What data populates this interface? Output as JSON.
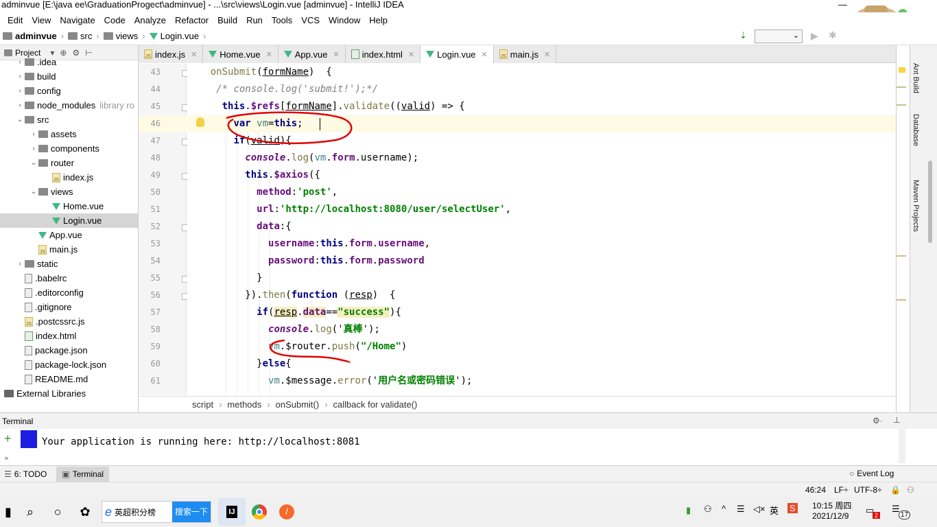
{
  "window": {
    "title": "adminvue [E:\\java ee\\GraduationProgect\\adminvue] - ...\\src\\views\\Login.vue [adminvue] - IntelliJ IDEA",
    "minimize": "—"
  },
  "menu": [
    "Edit",
    "View",
    "Navigate",
    "Code",
    "Analyze",
    "Refactor",
    "Build",
    "Run",
    "Tools",
    "VCS",
    "Window",
    "Help"
  ],
  "nav": {
    "project": "adminvue",
    "src": "src",
    "views": "views",
    "file": "Login.vue"
  },
  "sidebar": {
    "title": "Project",
    "library_label": "library ro"
  },
  "tree": [
    {
      "label": ".idea",
      "indent": 1,
      "arrow": "›",
      "icon": "folder"
    },
    {
      "label": "build",
      "indent": 1,
      "arrow": "›",
      "icon": "folder"
    },
    {
      "label": "config",
      "indent": 1,
      "arrow": "›",
      "icon": "folder"
    },
    {
      "label": "node_modules",
      "indent": 1,
      "arrow": "›",
      "icon": "folder",
      "muted": "library ro"
    },
    {
      "label": "src",
      "indent": 1,
      "arrow": "⌄",
      "icon": "folder"
    },
    {
      "label": "assets",
      "indent": 2,
      "arrow": "›",
      "icon": "folder"
    },
    {
      "label": "components",
      "indent": 2,
      "arrow": "›",
      "icon": "folder"
    },
    {
      "label": "router",
      "indent": 2,
      "arrow": "⌄",
      "icon": "folder"
    },
    {
      "label": "index.js",
      "indent": 3,
      "arrow": "",
      "icon": "js"
    },
    {
      "label": "views",
      "indent": 2,
      "arrow": "⌄",
      "icon": "folder"
    },
    {
      "label": "Home.vue",
      "indent": 3,
      "arrow": "",
      "icon": "vue"
    },
    {
      "label": "Login.vue",
      "indent": 3,
      "arrow": "",
      "icon": "vue",
      "selected": true
    },
    {
      "label": "App.vue",
      "indent": 2,
      "arrow": "",
      "icon": "vue"
    },
    {
      "label": "main.js",
      "indent": 2,
      "arrow": "",
      "icon": "js"
    },
    {
      "label": "static",
      "indent": 1,
      "arrow": "›",
      "icon": "folder"
    },
    {
      "label": ".babelrc",
      "indent": 1,
      "arrow": "",
      "icon": "file"
    },
    {
      "label": ".editorconfig",
      "indent": 1,
      "arrow": "",
      "icon": "file"
    },
    {
      "label": ".gitignore",
      "indent": 1,
      "arrow": "",
      "icon": "file"
    },
    {
      "label": ".postcssrc.js",
      "indent": 1,
      "arrow": "",
      "icon": "js"
    },
    {
      "label": "index.html",
      "indent": 1,
      "arrow": "",
      "icon": "html"
    },
    {
      "label": "package.json",
      "indent": 1,
      "arrow": "",
      "icon": "file"
    },
    {
      "label": "package-lock.json",
      "indent": 1,
      "arrow": "",
      "icon": "file"
    },
    {
      "label": "README.md",
      "indent": 1,
      "arrow": "",
      "icon": "file"
    },
    {
      "label": "External Libraries",
      "indent": 0,
      "arrow": "",
      "icon": "lib"
    }
  ],
  "tabs": [
    {
      "label": "index.js",
      "icon": "js"
    },
    {
      "label": "Home.vue",
      "icon": "vue"
    },
    {
      "label": "App.vue",
      "icon": "vue"
    },
    {
      "label": "index.html",
      "icon": "html"
    },
    {
      "label": "Login.vue",
      "icon": "vue",
      "active": true
    },
    {
      "label": "main.js",
      "icon": "js"
    }
  ],
  "line_numbers": [
    "43",
    "44",
    "45",
    "46",
    "47",
    "48",
    "49",
    "50",
    "51",
    "52",
    "53",
    "54",
    "55",
    "56",
    "57",
    "58",
    "59",
    "60",
    "61"
  ],
  "code": [
    {
      "parts": [
        [
          "    ",
          ""
        ],
        [
          "onSubmit",
          "fn"
        ],
        [
          "(",
          ""
        ],
        [
          "formName",
          "ul"
        ],
        [
          ")  {",
          ""
        ]
      ]
    },
    {
      "parts": [
        [
          "     ",
          ""
        ],
        [
          "/* console.log('submit!');*/",
          "cm"
        ]
      ]
    },
    {
      "parts": [
        [
          "      ",
          ""
        ],
        [
          "this",
          "kw"
        ],
        [
          ".",
          ""
        ],
        [
          "$refs",
          "pu"
        ],
        [
          "[",
          ""
        ],
        [
          "formName",
          "ul"
        ],
        [
          "].",
          ""
        ],
        [
          "validate",
          "fn"
        ],
        [
          "((",
          ""
        ],
        [
          "valid",
          "ul"
        ],
        [
          ") => {",
          ""
        ]
      ]
    },
    {
      "cur": true,
      "parts": [
        [
          "        ",
          ""
        ],
        [
          "var ",
          "kw"
        ],
        [
          "vm",
          "vv"
        ],
        [
          "=",
          ""
        ],
        [
          "this",
          "kw"
        ],
        [
          ";",
          ""
        ]
      ]
    },
    {
      "parts": [
        [
          "        ",
          ""
        ],
        [
          "if",
          "kw"
        ],
        [
          "(",
          ""
        ],
        [
          "valid",
          "ul"
        ],
        [
          "){",
          ""
        ]
      ]
    },
    {
      "parts": [
        [
          "          ",
          ""
        ],
        [
          "console",
          "it"
        ],
        [
          ".",
          ""
        ],
        [
          "log",
          "fn"
        ],
        [
          "(",
          ""
        ],
        [
          "vm",
          "vv"
        ],
        [
          ".",
          ""
        ],
        [
          "form",
          "pu"
        ],
        [
          ".username);",
          ""
        ]
      ]
    },
    {
      "parts": [
        [
          "          ",
          ""
        ],
        [
          "this",
          "kw"
        ],
        [
          ".",
          ""
        ],
        [
          "$axios",
          "pu"
        ],
        [
          "({",
          ""
        ]
      ]
    },
    {
      "parts": [
        [
          "            ",
          ""
        ],
        [
          "method",
          "pu"
        ],
        [
          ":",
          ""
        ],
        [
          "'post'",
          "str"
        ],
        [
          ",",
          ""
        ]
      ]
    },
    {
      "parts": [
        [
          "            ",
          ""
        ],
        [
          "url",
          "pu"
        ],
        [
          ":",
          ""
        ],
        [
          "'http://localhost:8080/user/selectUser'",
          "str"
        ],
        [
          ",",
          ""
        ]
      ]
    },
    {
      "parts": [
        [
          "            ",
          ""
        ],
        [
          "data",
          "pu"
        ],
        [
          ":{",
          ""
        ]
      ]
    },
    {
      "parts": [
        [
          "              ",
          ""
        ],
        [
          "username",
          "pu"
        ],
        [
          ":",
          ""
        ],
        [
          "this",
          "kw"
        ],
        [
          ".",
          ""
        ],
        [
          "form",
          "pu"
        ],
        [
          ".",
          ""
        ],
        [
          "username",
          "pu"
        ],
        [
          ",",
          ""
        ]
      ]
    },
    {
      "parts": [
        [
          "              ",
          ""
        ],
        [
          "password",
          "pu"
        ],
        [
          ":",
          ""
        ],
        [
          "this",
          "kw"
        ],
        [
          ".",
          ""
        ],
        [
          "form",
          "pu"
        ],
        [
          ".",
          ""
        ],
        [
          "password",
          "pu"
        ]
      ]
    },
    {
      "parts": [
        [
          "            }",
          ""
        ]
      ]
    },
    {
      "parts": [
        [
          "          }).",
          ""
        ],
        [
          "then",
          "fn"
        ],
        [
          "(",
          ""
        ],
        [
          "function ",
          "kw"
        ],
        [
          "(",
          ""
        ],
        [
          "resp",
          "ul"
        ],
        [
          ")  {",
          ""
        ]
      ]
    },
    {
      "parts": [
        [
          "            ",
          ""
        ],
        [
          "if",
          "kw"
        ],
        [
          "(",
          ""
        ],
        [
          "resp",
          "ul hl"
        ],
        [
          ".",
          ""
        ],
        [
          "data",
          "pu hl"
        ],
        [
          "==",
          ""
        ],
        [
          "\"success\"",
          "str hl"
        ],
        [
          "){",
          ""
        ]
      ]
    },
    {
      "parts": [
        [
          "              ",
          ""
        ],
        [
          "console",
          "it"
        ],
        [
          ".",
          ""
        ],
        [
          "log",
          "fn"
        ],
        [
          "('",
          ""
        ],
        [
          "真棒",
          "str"
        ],
        [
          "');",
          ""
        ]
      ]
    },
    {
      "parts": [
        [
          "              ",
          ""
        ],
        [
          "vm",
          "vv"
        ],
        [
          ".$router.",
          ""
        ],
        [
          "push",
          "fn"
        ],
        [
          "(",
          ""
        ],
        [
          "\"/Home\"",
          "str"
        ],
        [
          ")",
          ""
        ]
      ]
    },
    {
      "parts": [
        [
          "            }",
          ""
        ],
        [
          "else",
          "kw"
        ],
        [
          "{",
          ""
        ]
      ]
    },
    {
      "parts": [
        [
          "              ",
          ""
        ],
        [
          "vm",
          "vv"
        ],
        [
          ".$message.",
          ""
        ],
        [
          "error",
          "fn"
        ],
        [
          "('",
          ""
        ],
        [
          "用户名或密码错误",
          "str"
        ],
        [
          "');",
          ""
        ]
      ]
    }
  ],
  "breadcrumb": [
    "script",
    "methods",
    "onSubmit()",
    "callback for validate()"
  ],
  "right_panel": [
    "Ant Build",
    "Database",
    "Maven Projects"
  ],
  "terminal": {
    "title": "Terminal",
    "output": "Your application is running here: http://localhost:8081"
  },
  "toolwindows": {
    "todo": "6: TODO",
    "terminal": "Terminal",
    "event_log": "Event Log"
  },
  "status": {
    "position": "46:24",
    "line_sep": "LF÷",
    "encoding": "UTF-8÷"
  },
  "taskbar": {
    "search_text": "英超积分榜",
    "search_button": "搜索一下",
    "time": "10:15 周四",
    "date": "2021/12/9",
    "notif_count": "2",
    "badge": "17"
  },
  "colors": {
    "vue": "#41b883",
    "accent_blue": "#1e6ee8",
    "annotation": "#e00000"
  }
}
